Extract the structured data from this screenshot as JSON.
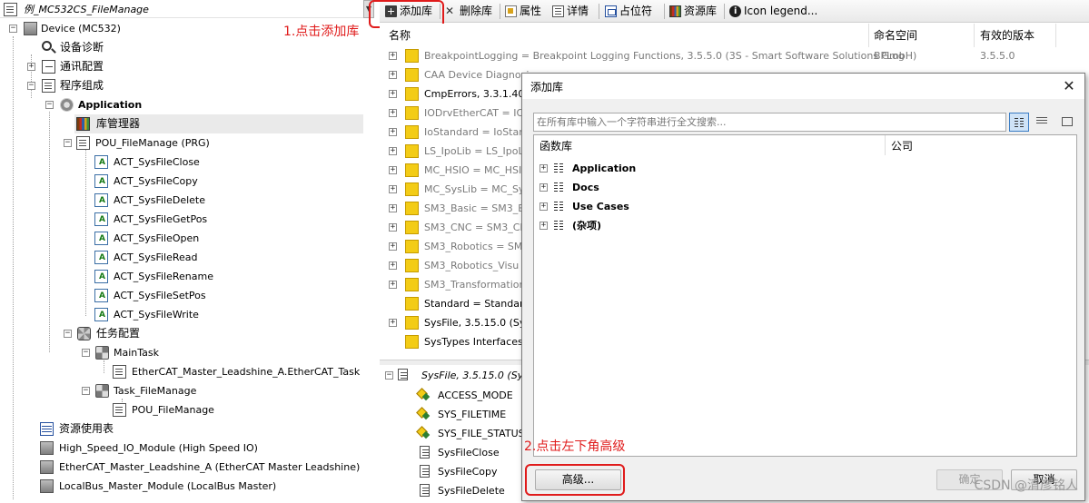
{
  "tree": {
    "root_title": "例_MC532CS_FileManage",
    "items": [
      {
        "label": "Device (MC532)"
      },
      {
        "label": "设备诊断"
      },
      {
        "label": "通讯配置"
      },
      {
        "label": "程序组成"
      },
      {
        "label": "Application"
      },
      {
        "label": "库管理器"
      },
      {
        "label": "POU_FileManage (PRG)"
      },
      {
        "label": "ACT_SysFileClose"
      },
      {
        "label": "ACT_SysFileCopy"
      },
      {
        "label": "ACT_SysFileDelete"
      },
      {
        "label": "ACT_SysFileGetPos"
      },
      {
        "label": "ACT_SysFileOpen"
      },
      {
        "label": "ACT_SysFileRead"
      },
      {
        "label": "ACT_SysFileRename"
      },
      {
        "label": "ACT_SysFileSetPos"
      },
      {
        "label": "ACT_SysFileWrite"
      },
      {
        "label": "任务配置"
      },
      {
        "label": "MainTask"
      },
      {
        "label": "EtherCAT_Master_Leadshine_A.EtherCAT_Task"
      },
      {
        "label": "Task_FileManage"
      },
      {
        "label": "POU_FileManage"
      },
      {
        "label": "资源使用表"
      },
      {
        "label": "High_Speed_IO_Module (High Speed IO)"
      },
      {
        "label": "EtherCAT_Master_Leadshine_A (EtherCAT Master Leadshine)"
      },
      {
        "label": "LocalBus_Master_Module (LocalBus Master)"
      }
    ]
  },
  "annotations": {
    "step1": "1.点击添加库",
    "step2": "2.点击左下角高级"
  },
  "toolbar": {
    "add_library": "添加库",
    "delete_library": "删除库",
    "properties": "属性",
    "details": "详情",
    "placeholders": "占位符",
    "library_repository": "资源库",
    "icon_legend": "Icon legend..."
  },
  "library_grid": {
    "headers": {
      "name": "名称",
      "namespace": "命名空间",
      "effective_version": "有效的版本"
    },
    "rows": [
      {
        "name": "BreakpointLogging = Breakpoint Logging Functions, 3.5.5.0 (3S - Smart Software Solutions GmbH)",
        "namespace": "BPLog",
        "version": "3.5.5.0",
        "dim": true,
        "expandable": true
      },
      {
        "name": "CAA Device Diagnosis",
        "namespace": "",
        "version": "",
        "dim": true,
        "expandable": true
      },
      {
        "name": "CmpErrors, 3.3.1.40 (",
        "namespace": "",
        "version": "",
        "dim": false,
        "expandable": true
      },
      {
        "name": "IODrvEtherCAT = IOD",
        "namespace": "",
        "version": "",
        "dim": true,
        "expandable": true
      },
      {
        "name": "IoStandard = IoStand",
        "namespace": "",
        "version": "",
        "dim": true,
        "expandable": true
      },
      {
        "name": "LS_IpoLib = LS_IpoLib",
        "namespace": "",
        "version": "",
        "dim": true,
        "expandable": true
      },
      {
        "name": "MC_HSIO = MC_HSIO",
        "namespace": "",
        "version": "",
        "dim": true,
        "expandable": true
      },
      {
        "name": "MC_SysLib = MC_SysLi",
        "namespace": "",
        "version": "",
        "dim": true,
        "expandable": true
      },
      {
        "name": "SM3_Basic = SM3_Bas",
        "namespace": "",
        "version": "",
        "dim": true,
        "expandable": true
      },
      {
        "name": "SM3_CNC = SM3_CNC",
        "namespace": "",
        "version": "",
        "dim": true,
        "expandable": true
      },
      {
        "name": "SM3_Robotics = SM3_",
        "namespace": "",
        "version": "",
        "dim": true,
        "expandable": true
      },
      {
        "name": "SM3_Robotics_Visu =",
        "namespace": "",
        "version": "",
        "dim": true,
        "expandable": true
      },
      {
        "name": "SM3_Transformation =",
        "namespace": "",
        "version": "",
        "dim": true,
        "expandable": true
      },
      {
        "name": "Standard = Standard,",
        "namespace": "",
        "version": "",
        "dim": false,
        "expandable": false
      },
      {
        "name": "SysFile, 3.5.15.0 (Sys",
        "namespace": "",
        "version": "",
        "dim": false,
        "expandable": true
      },
      {
        "name": "SysTypes Interfaces,",
        "namespace": "",
        "version": "",
        "dim": false,
        "expandable": false
      }
    ]
  },
  "library_content": {
    "title": "SysFile, 3.5.15.0 (Syst",
    "items": [
      {
        "label": "ACCESS_MODE"
      },
      {
        "label": "SYS_FILETIME"
      },
      {
        "label": "SYS_FILE_STATUS"
      },
      {
        "label": "SysFileClose"
      },
      {
        "label": "SysFileCopy"
      },
      {
        "label": "SysFileDelete"
      }
    ]
  },
  "dialog": {
    "title": "添加库",
    "close": "✕",
    "search_placeholder": "在所有库中输入一个字符串进行全文搜索...",
    "headers": {
      "library": "函数库",
      "company": "公司"
    },
    "categories": [
      {
        "label": "Application"
      },
      {
        "label": "Docs"
      },
      {
        "label": "Use Cases"
      },
      {
        "label": "(杂项)"
      }
    ],
    "advanced_button": "高级...",
    "ok_button": "确定",
    "cancel_button": "取消"
  },
  "watermark": "CSDN @清彦铭人",
  "colors": {
    "annotation_red": "#e01b1b",
    "folder_yellow": "#f3cc16",
    "selection_grey": "#eaeaea"
  }
}
